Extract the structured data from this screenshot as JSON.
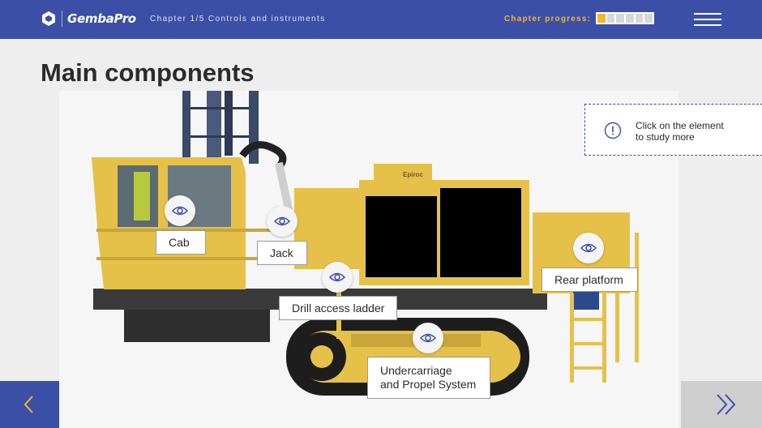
{
  "header": {
    "brand": "GembaPro",
    "chapter": "Chapter 1/5 Controls and instruments",
    "progress_label": "Chapter progress:",
    "progress": {
      "completed": 1,
      "total": 6
    }
  },
  "page": {
    "title": "Main components"
  },
  "hint": {
    "text": "Click on the element\nto study more"
  },
  "machine": {
    "brand_plate": "Epiroc"
  },
  "components": [
    {
      "id": "cab",
      "label": "Cab"
    },
    {
      "id": "jack",
      "label": "Jack"
    },
    {
      "id": "drill-access-ladder",
      "label": "Drill access ladder"
    },
    {
      "id": "rear-platform",
      "label": "Rear platform"
    },
    {
      "id": "undercarriage",
      "label": "Undercarriage\nand Propel System"
    }
  ],
  "colors": {
    "header_bg": "#3b4fa6",
    "accent": "#f2b733",
    "machine_yellow": "#e6c14a",
    "nav_next_bg": "#cfcfcf"
  },
  "icons": {
    "brand": "hexagon-logo-icon",
    "menu": "hamburger-menu-icon",
    "hint": "exclamation-circle-icon",
    "hotspot": "eye-icon",
    "prev": "chevron-left-icon",
    "next": "double-chevron-right-icon"
  }
}
